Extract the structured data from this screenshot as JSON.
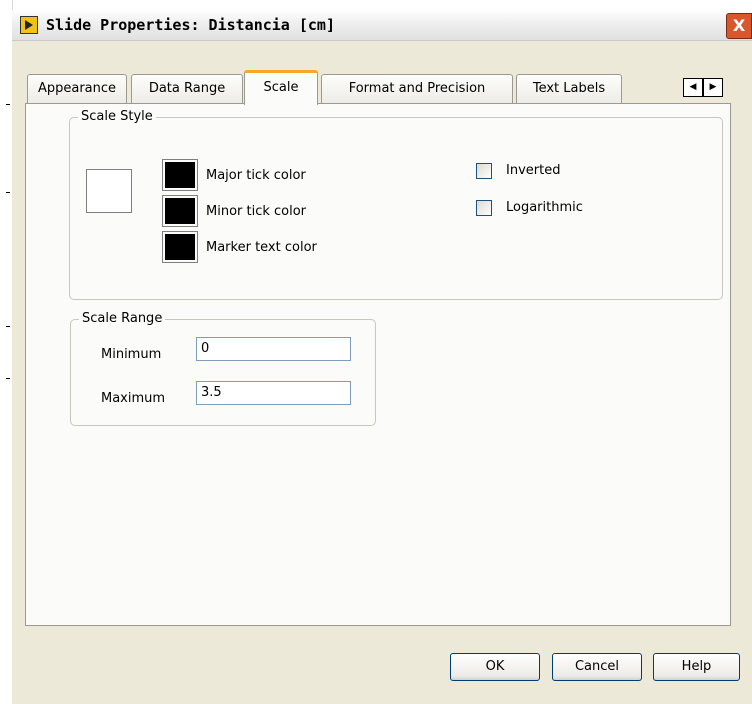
{
  "window": {
    "title": "Slide Properties: Distancia [cm]",
    "close_label": "X"
  },
  "tabs": [
    {
      "label": "Appearance",
      "active": false
    },
    {
      "label": "Data Range",
      "active": false
    },
    {
      "label": "Scale",
      "active": true
    },
    {
      "label": "Format and Precision",
      "active": false
    },
    {
      "label": "Text Labels",
      "active": false
    }
  ],
  "tab_scroll": {
    "left_icon": "triangle-left-icon",
    "right_icon": "triangle-right-icon"
  },
  "scale_style": {
    "legend": "Scale Style",
    "major_tick_color": {
      "label": "Major tick color",
      "color": "#000000"
    },
    "minor_tick_color": {
      "label": "Minor tick color",
      "color": "#000000"
    },
    "marker_text_color": {
      "label": "Marker text color",
      "color": "#000000"
    },
    "inverted": {
      "label": "Inverted",
      "checked": false
    },
    "logarithmic": {
      "label": "Logarithmic",
      "checked": false
    }
  },
  "scale_range": {
    "legend": "Scale Range",
    "minimum": {
      "label": "Minimum",
      "value": "0"
    },
    "maximum": {
      "label": "Maximum",
      "value": "3.5"
    }
  },
  "buttons": {
    "ok": "OK",
    "cancel": "Cancel",
    "help": "Help"
  },
  "colors": {
    "active_tab_accent": "#f6a928",
    "dialog_bg": "#ece9d8",
    "panel_bg": "#fbfbf9"
  }
}
